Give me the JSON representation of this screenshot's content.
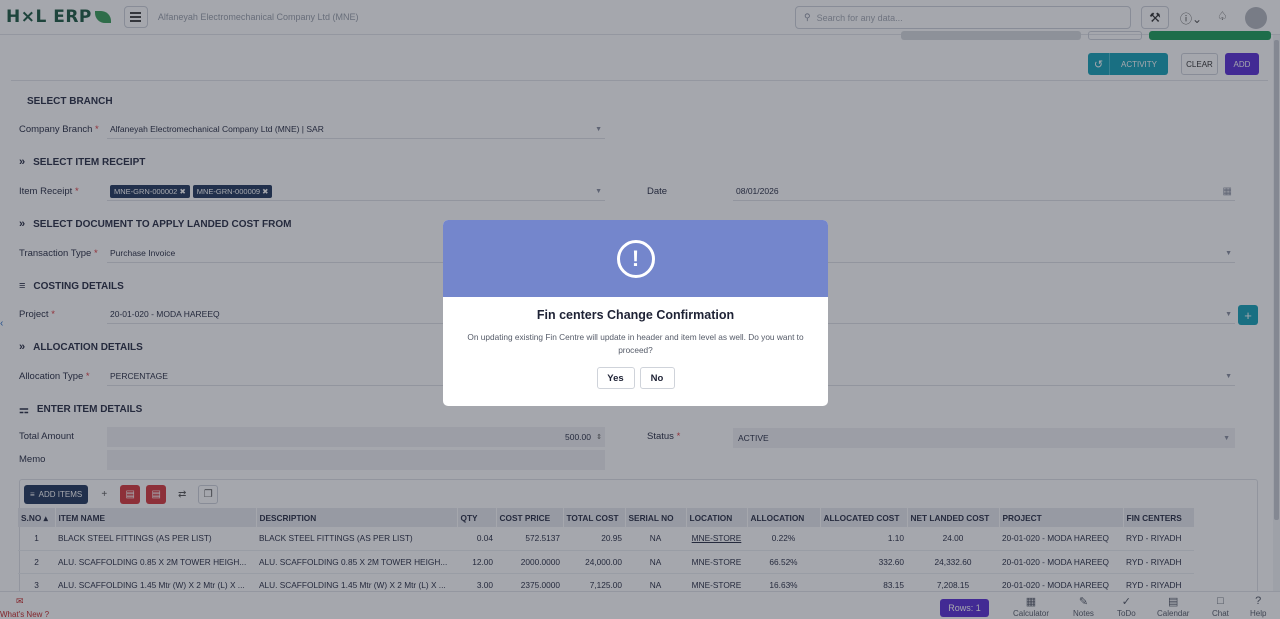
{
  "topbar": {
    "logo_text": "H⨯L ERP",
    "company_name": "Alfaneyah Electromechanical Company Ltd (MNE)",
    "search_placeholder": "Search for any data..."
  },
  "toolbar": {
    "activity_label": "ACTIVITY",
    "clear_label": "CLEAR",
    "add_label": "ADD"
  },
  "sections": {
    "select_branch": "SELECT BRANCH",
    "select_item_receipt": "SELECT ITEM RECEIPT",
    "select_document": "SELECT DOCUMENT TO APPLY LANDED COST FROM",
    "costing_details": "COSTING DETAILS",
    "allocation_details": "ALLOCATION DETAILS",
    "enter_item_details": "ENTER ITEM DETAILS"
  },
  "form": {
    "company_branch_label": "Company Branch",
    "company_branch_value": "Alfaneyah Electromechanical Company Ltd (MNE) | SAR",
    "item_receipt_label": "Item Receipt",
    "item_receipt_tags": [
      "MNE-GRN-000002",
      "MNE-GRN-000009"
    ],
    "date_label": "Date",
    "date_value": "08/01/2026",
    "transaction_type_label": "Transaction Type",
    "transaction_type_value": "Purchase Invoice",
    "project_label": "Project",
    "project_value": "20-01-020 - MODA HAREEQ",
    "allocation_type_label": "Allocation Type",
    "allocation_type_value": "PERCENTAGE",
    "total_amount_label": "Total Amount",
    "total_amount_value": "500.00",
    "status_label": "Status",
    "status_value": "ACTIVE",
    "memo_label": "Memo",
    "required_mark": "*"
  },
  "grid": {
    "add_items_label": "ADD ITEMS",
    "columns": [
      "S.NO",
      "ITEM NAME",
      "DESCRIPTION",
      "QTY",
      "COST PRICE",
      "TOTAL COST",
      "SERIAL NO",
      "LOCATION",
      "ALLOCATION",
      "ALLOCATED COST",
      "NET LANDED COST",
      "PROJECT",
      "FIN CENTERS"
    ],
    "rows": [
      [
        "1",
        "BLACK STEEL FITTINGS (AS PER LIST)",
        "BLACK STEEL FITTINGS (AS PER LIST)",
        "0.04",
        "572.5137",
        "20.95",
        "NA",
        "MNE-STORE",
        "0.22%",
        "1.10",
        "24.00",
        "20-01-020 - MODA HAREEQ",
        "RYD - RIYADH"
      ],
      [
        "2",
        "ALU. SCAFFOLDING 0.85 X 2M TOWER HEIGH...",
        "ALU. SCAFFOLDING 0.85 X 2M TOWER HEIGH...",
        "12.00",
        "2000.0000",
        "24,000.00",
        "NA",
        "MNE-STORE",
        "66.52%",
        "332.60",
        "24,332.60",
        "20-01-020 - MODA HAREEQ",
        "RYD - RIYADH"
      ],
      [
        "3",
        "ALU. SCAFFOLDING 1.45 Mtr (W) X 2 Mtr (L) X ...",
        "ALU. SCAFFOLDING 1.45 Mtr (W) X 2 Mtr (L) X ...",
        "3.00",
        "2375.0000",
        "7,125.00",
        "NA",
        "MNE-STORE",
        "16.63%",
        "83.15",
        "7,208.15",
        "20-01-020 - MODA HAREEQ",
        "RYD - RIYADH"
      ]
    ]
  },
  "modal": {
    "title": "Fin centers Change Confirmation",
    "message": "On updating existing Fin Centre will update in header and item level as well. Do you want to proceed?",
    "yes_label": "Yes",
    "no_label": "No"
  },
  "footer": {
    "whats_new": "What's New ?",
    "rows_label": "Rows: 1",
    "items": [
      "Calculator",
      "Notes",
      "ToDo",
      "Calendar",
      "Chat",
      "Help"
    ]
  },
  "colors": {
    "modal_header": "#7486cc",
    "primary_purple": "#5a2fd6",
    "activity_teal": "#17a2b8",
    "delete_red": "#d8393f",
    "dark_navy": "#243a5e"
  }
}
